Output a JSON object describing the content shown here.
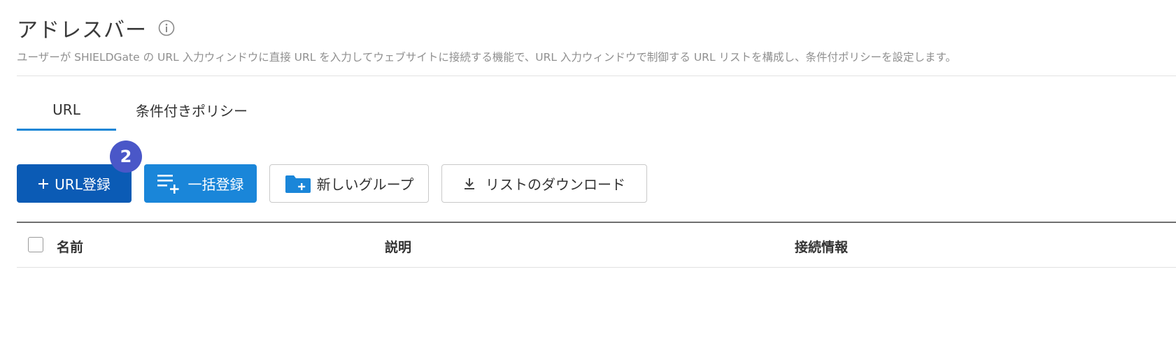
{
  "header": {
    "title": "アドレスバー",
    "description": "ユーザーが SHIELDGate の URL 入力ウィンドウに直接 URL を入力してウェブサイトに接続する機能で、URL 入力ウィンドウで制御する URL リストを構成し、条件付ポリシーを設定します。"
  },
  "tabs": [
    {
      "label": "URL",
      "active": true
    },
    {
      "label": "条件付きポリシー",
      "active": false
    }
  ],
  "step_badge": "2",
  "toolbar": {
    "url_register_label": "URL登録",
    "bulk_register_label": "一括登録",
    "new_group_label": "新しいグループ",
    "download_list_label": "リストのダウンロード"
  },
  "table": {
    "columns": [
      "名前",
      "説明",
      "接続情報"
    ]
  },
  "colors": {
    "accent_dark": "#0b5bb5",
    "accent": "#1a86d9",
    "badge": "#4a57c8",
    "tab_underline": "#1a86d6"
  },
  "icons": [
    "info-icon",
    "plus-icon",
    "list-add-icon",
    "folder-add-icon",
    "download-icon"
  ]
}
